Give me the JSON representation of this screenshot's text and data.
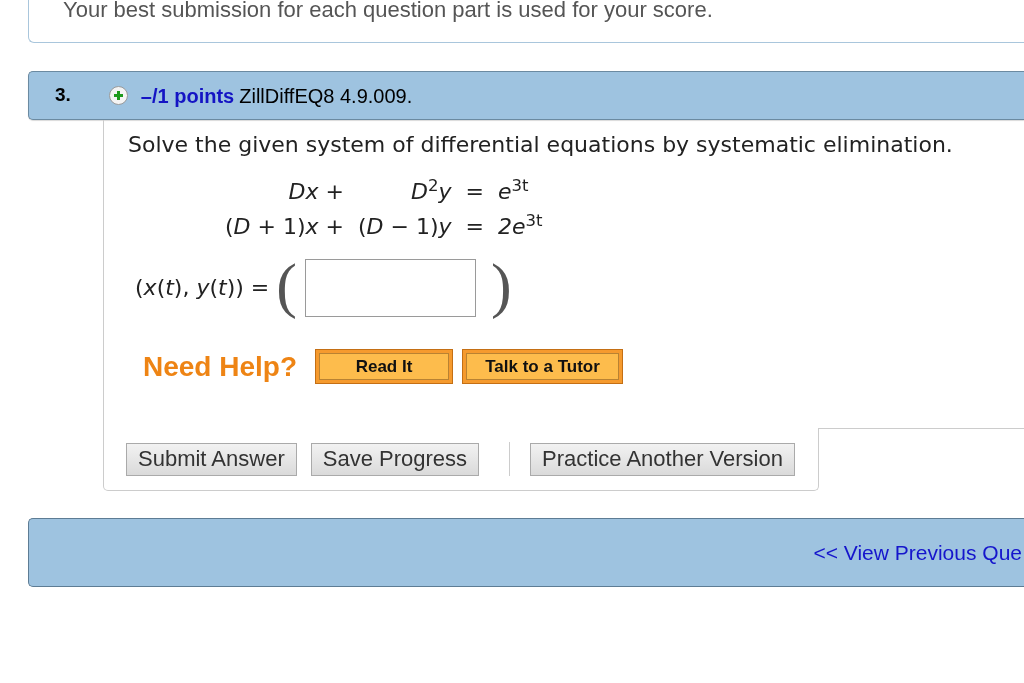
{
  "notice": {
    "text": "Your best submission for each question part is used for your score."
  },
  "question": {
    "number": "3.",
    "points": "–/1 points",
    "source": "ZillDiffEQ8 4.9.009.",
    "prompt": "Solve the given system of differential equations by systematic elimination.",
    "equations": [
      {
        "term_1": "*Dx* +",
        "term_2": "*D*$^{2}$*y*",
        "relation": "=",
        "rhs": "*e*$^{3t}$"
      },
      {
        "term_1": "(*D* + 1)*x* +",
        "term_2": "(*D* − 1)*y*",
        "relation": "=",
        "rhs": "*2e*$^{3t}$"
      }
    ],
    "answer": {
      "label": "(*x*(*t*), *y*(*t*)) =",
      "open_paren": "(",
      "close_paren": ")"
    },
    "help": {
      "label": "Need Help?",
      "buttons": [
        "Read It",
        "Talk to a Tutor"
      ]
    },
    "action_groups": [
      [
        "Submit Answer",
        "Save Progress"
      ],
      [
        "Practice Another Version"
      ]
    ]
  },
  "navigation": {
    "previous_link": "<< View Previous Que"
  }
}
